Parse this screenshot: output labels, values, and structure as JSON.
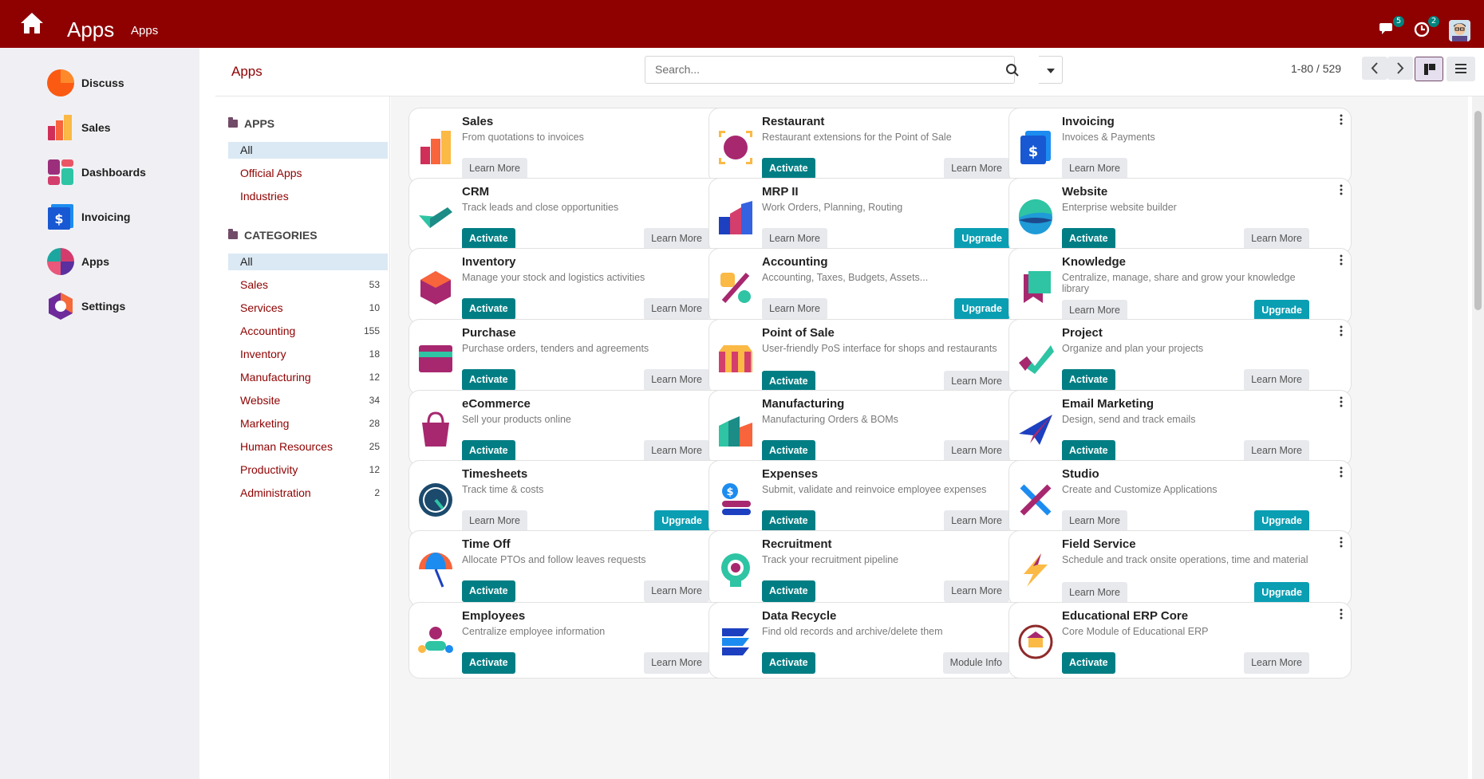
{
  "topbar": {
    "title": "Apps",
    "menu_item": "Apps",
    "messages_count": "5",
    "activities_count": "2"
  },
  "sidebar": {
    "items": [
      {
        "label": "Discuss",
        "icon": "discuss-icon"
      },
      {
        "label": "Sales",
        "icon": "sales-icon"
      },
      {
        "label": "Dashboards",
        "icon": "dashboards-icon"
      },
      {
        "label": "Invoicing",
        "icon": "invoicing-icon"
      },
      {
        "label": "Apps",
        "icon": "apps-icon"
      },
      {
        "label": "Settings",
        "icon": "settings-icon"
      }
    ]
  },
  "control_panel": {
    "title": "Apps",
    "search_placeholder": "Search...",
    "pager": "1-80 / 529"
  },
  "search_panel": {
    "apps_header": "APPS",
    "apps_items": [
      "All",
      "Official Apps",
      "Industries"
    ],
    "categories_header": "CATEGORIES",
    "categories": [
      {
        "label": "All",
        "count": ""
      },
      {
        "label": "Sales",
        "count": "53"
      },
      {
        "label": "Services",
        "count": "10"
      },
      {
        "label": "Accounting",
        "count": "155"
      },
      {
        "label": "Inventory",
        "count": "18"
      },
      {
        "label": "Manufacturing",
        "count": "12"
      },
      {
        "label": "Website",
        "count": "34"
      },
      {
        "label": "Marketing",
        "count": "28"
      },
      {
        "label": "Human Resources",
        "count": "25"
      },
      {
        "label": "Productivity",
        "count": "12"
      },
      {
        "label": "Administration",
        "count": "2"
      }
    ]
  },
  "apps": [
    {
      "name": "Sales",
      "desc": "From quotations to invoices",
      "buttons": [
        "Learn More"
      ],
      "icon": "sales-app-icon"
    },
    {
      "name": "Restaurant",
      "desc": "Restaurant extensions for the Point of Sale",
      "buttons": [
        "Activate",
        "Learn More"
      ],
      "icon": "restaurant-app-icon"
    },
    {
      "name": "Invoicing",
      "desc": "Invoices & Payments",
      "buttons": [
        "Learn More"
      ],
      "icon": "invoicing-app-icon"
    },
    {
      "name": "CRM",
      "desc": "Track leads and close opportunities",
      "buttons": [
        "Activate",
        "Learn More"
      ],
      "icon": "crm-app-icon"
    },
    {
      "name": "MRP II",
      "desc": "Work Orders, Planning, Routing",
      "buttons": [
        "Learn More",
        "Upgrade"
      ],
      "icon": "mrp-app-icon"
    },
    {
      "name": "Website",
      "desc": "Enterprise website builder",
      "buttons": [
        "Activate",
        "Learn More"
      ],
      "icon": "website-app-icon"
    },
    {
      "name": "Inventory",
      "desc": "Manage your stock and logistics activities",
      "buttons": [
        "Activate",
        "Learn More"
      ],
      "icon": "inventory-app-icon"
    },
    {
      "name": "Accounting",
      "desc": "Accounting, Taxes, Budgets, Assets...",
      "buttons": [
        "Learn More",
        "Upgrade"
      ],
      "icon": "accounting-app-icon"
    },
    {
      "name": "Knowledge",
      "desc": "Centralize, manage, share and grow your knowledge library",
      "buttons": [
        "Learn More",
        "Upgrade"
      ],
      "icon": "knowledge-app-icon"
    },
    {
      "name": "Purchase",
      "desc": "Purchase orders, tenders and agreements",
      "buttons": [
        "Activate",
        "Learn More"
      ],
      "icon": "purchase-app-icon"
    },
    {
      "name": "Point of Sale",
      "desc": "User-friendly PoS interface for shops and restaurants",
      "buttons": [
        "Activate",
        "Learn More"
      ],
      "icon": "pos-app-icon"
    },
    {
      "name": "Project",
      "desc": "Organize and plan your projects",
      "buttons": [
        "Activate",
        "Learn More"
      ],
      "icon": "project-app-icon"
    },
    {
      "name": "eCommerce",
      "desc": "Sell your products online",
      "buttons": [
        "Activate",
        "Learn More"
      ],
      "icon": "ecommerce-app-icon"
    },
    {
      "name": "Manufacturing",
      "desc": "Manufacturing Orders & BOMs",
      "buttons": [
        "Activate",
        "Learn More"
      ],
      "icon": "manufacturing-app-icon"
    },
    {
      "name": "Email Marketing",
      "desc": "Design, send and track emails",
      "buttons": [
        "Activate",
        "Learn More"
      ],
      "icon": "email-marketing-app-icon"
    },
    {
      "name": "Timesheets",
      "desc": "Track time & costs",
      "buttons": [
        "Learn More",
        "Upgrade"
      ],
      "icon": "timesheets-app-icon"
    },
    {
      "name": "Expenses",
      "desc": "Submit, validate and reinvoice employee expenses",
      "buttons": [
        "Activate",
        "Learn More"
      ],
      "icon": "expenses-app-icon"
    },
    {
      "name": "Studio",
      "desc": "Create and Customize Applications",
      "buttons": [
        "Learn More",
        "Upgrade"
      ],
      "icon": "studio-app-icon"
    },
    {
      "name": "Time Off",
      "desc": "Allocate PTOs and follow leaves requests",
      "buttons": [
        "Activate",
        "Learn More"
      ],
      "icon": "time-off-app-icon"
    },
    {
      "name": "Recruitment",
      "desc": "Track your recruitment pipeline",
      "buttons": [
        "Activate",
        "Learn More"
      ],
      "icon": "recruitment-app-icon"
    },
    {
      "name": "Field Service",
      "desc": "Schedule and track onsite operations, time and material",
      "buttons": [
        "Learn More",
        "Upgrade"
      ],
      "icon": "field-service-app-icon"
    },
    {
      "name": "Employees",
      "desc": "Centralize employee information",
      "buttons": [
        "Activate",
        "Learn More"
      ],
      "icon": "employees-app-icon"
    },
    {
      "name": "Data Recycle",
      "desc": "Find old records and archive/delete them",
      "buttons": [
        "Activate",
        "Module Info"
      ],
      "icon": "data-recycle-app-icon"
    },
    {
      "name": "Educational ERP Core",
      "desc": "Core Module of Educational ERP",
      "buttons": [
        "Activate",
        "Learn More"
      ],
      "icon": "educational-erp-app-icon"
    }
  ]
}
